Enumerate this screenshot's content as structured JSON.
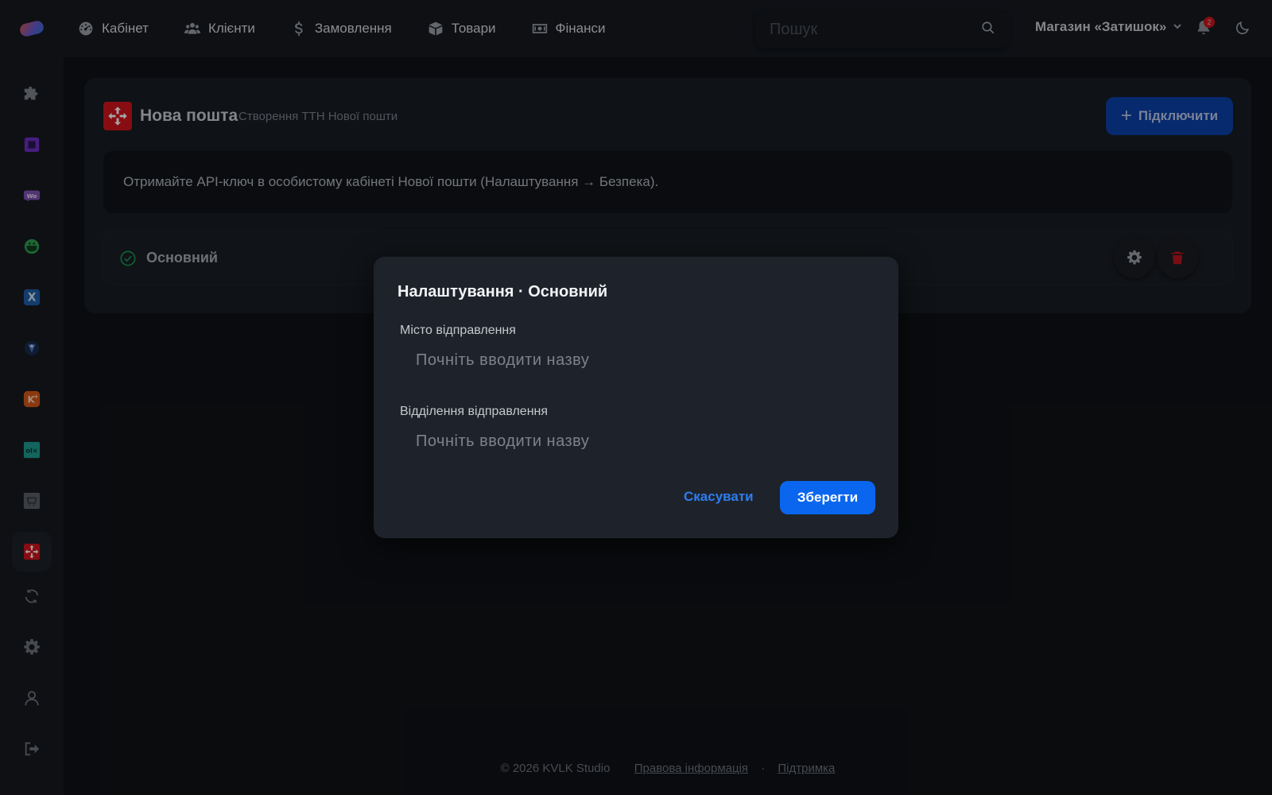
{
  "topbar": {
    "nav": [
      {
        "label": "Кабінет",
        "icon": "dashboard-icon"
      },
      {
        "label": "Клієнти",
        "icon": "users-icon"
      },
      {
        "label": "Замовлення",
        "icon": "dollar-icon"
      },
      {
        "label": "Товари",
        "icon": "box-icon"
      },
      {
        "label": "Фінанси",
        "icon": "money-icon"
      }
    ],
    "search_placeholder": "Пошук",
    "store_label": "Магазин «Затишок»",
    "notification_count": "2"
  },
  "sidebar": {
    "items": [
      {
        "name": "plugins",
        "icon": "puzzle-icon",
        "color": "#8a9098"
      },
      {
        "name": "integration-purple",
        "icon": "square-app-icon",
        "color": "#7b3fd1"
      },
      {
        "name": "woocommerce",
        "icon": "woo-icon",
        "color": "#7f54b3"
      },
      {
        "name": "integration-green",
        "icon": "green-app-icon",
        "color": "#2e9e4f"
      },
      {
        "name": "integration-x",
        "icon": "x-app-icon",
        "color": "#2a6fbf"
      },
      {
        "name": "integration-shield",
        "icon": "shield-app-icon",
        "color": "#4a78c9"
      },
      {
        "name": "integration-orange",
        "icon": "k-app-icon",
        "color": "#e0651d"
      },
      {
        "name": "olx",
        "icon": "olx-icon",
        "color": "#23a99e"
      },
      {
        "name": "integration-shop",
        "icon": "shop-app-icon",
        "color": "#7d838b"
      },
      {
        "name": "nova-poshta",
        "icon": "nova-poshta-icon",
        "color": "#d0141c",
        "active": true
      },
      {
        "name": "sync",
        "icon": "sync-icon",
        "color": "#8a9098"
      },
      {
        "name": "settings",
        "icon": "gear-icon",
        "color": "#8a9098"
      },
      {
        "name": "profile",
        "icon": "user-icon",
        "color": "#8a9098"
      },
      {
        "name": "logout",
        "icon": "logout-icon",
        "color": "#8a9098"
      }
    ]
  },
  "card": {
    "title": "Нова пошта",
    "subtitle": "Створення ТТН Нової пошти",
    "connect_label": "Підключити",
    "info_text": "Отримайте API-ключ в особистому кабінеті Нової пошти (Налаштування → Безпека).",
    "account_name": "Основний"
  },
  "modal": {
    "title": "Налаштування · Основний",
    "city_label": "Місто відправлення",
    "city_placeholder": "Почніть вводити назву",
    "branch_label": "Відділення відправлення",
    "branch_placeholder": "Почніть вводити назву",
    "cancel_label": "Скасувати",
    "save_label": "Зберегти"
  },
  "footer": {
    "copyright": "© 2026 KVLK Studio",
    "legal_link": "Правова інформація",
    "separator": "·",
    "support_link": "Підтримка"
  },
  "colors": {
    "accent": "#0a66ee",
    "nova_poshta_red": "#d0141c",
    "success": "#1c8a4e",
    "danger": "#b5161d"
  }
}
